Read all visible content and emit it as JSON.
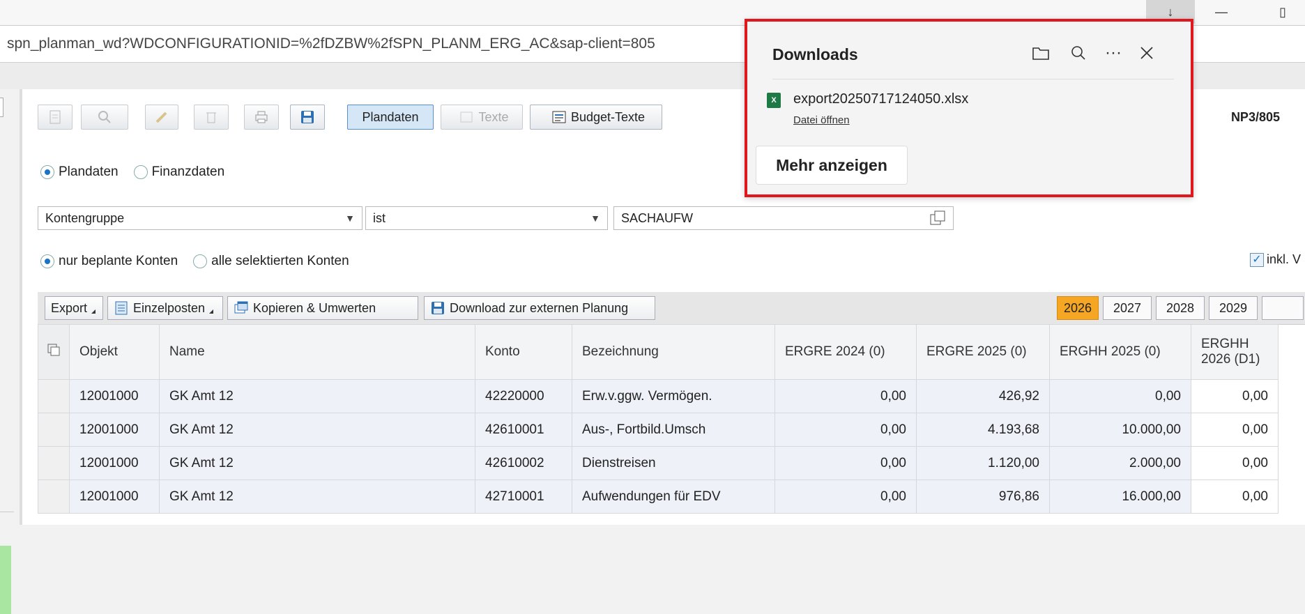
{
  "browser": {
    "url": "spn_planman_wd?WDCONFIGURATIONID=%2fDZBW%2fSPN_PLANM_ERG_AC&sap-client=805"
  },
  "toolbar": {
    "plandaten_label": "Plandaten",
    "texte_label": "Texte",
    "budget_texte_label": "Budget-Texte",
    "system_id": "NP3/805"
  },
  "radio_data": {
    "plandaten": "Plandaten",
    "finanzdaten": "Finanzdaten"
  },
  "filter": {
    "field": "Kontengruppe",
    "operator": "ist",
    "value": "SACHAUFW"
  },
  "radio_konten": {
    "nur_beplante": "nur beplante Konten",
    "alle_selektierten": "alle selektierten Konten"
  },
  "checkbox_inkl": "inkl. V",
  "table_toolbar": {
    "export": "Export",
    "einzelposten": "Einzelposten",
    "kopieren": "Kopieren & Umwerten",
    "download": "Download zur externen Planung",
    "years": [
      "2026",
      "2027",
      "2028",
      "2029"
    ]
  },
  "table": {
    "headers": [
      "Objekt",
      "Name",
      "Konto",
      "Bezeichnung",
      "ERGRE 2024 (0)",
      "ERGRE 2025 (0)",
      "ERGHH 2025 (0)",
      "ERGHH 2026 (D1)"
    ],
    "rows": [
      [
        "12001000",
        "GK Amt 12",
        "42220000",
        "Erw.v.ggw. Vermögen.",
        "0,00",
        "426,92",
        "0,00",
        "0,00"
      ],
      [
        "12001000",
        "GK Amt 12",
        "42610001",
        "Aus-, Fortbild.Umsch",
        "0,00",
        "4.193,68",
        "10.000,00",
        "0,00"
      ],
      [
        "12001000",
        "GK Amt 12",
        "42610002",
        "Dienstreisen",
        "0,00",
        "1.120,00",
        "2.000,00",
        "0,00"
      ],
      [
        "12001000",
        "GK Amt 12",
        "42710001",
        "Aufwendungen für EDV",
        "0,00",
        "976,86",
        "16.000,00",
        "0,00"
      ]
    ]
  },
  "downloads": {
    "title": "Downloads",
    "file_name": "export20250717124050.xlsx",
    "open_label": "Datei öffnen",
    "more_label": "Mehr anzeigen"
  }
}
